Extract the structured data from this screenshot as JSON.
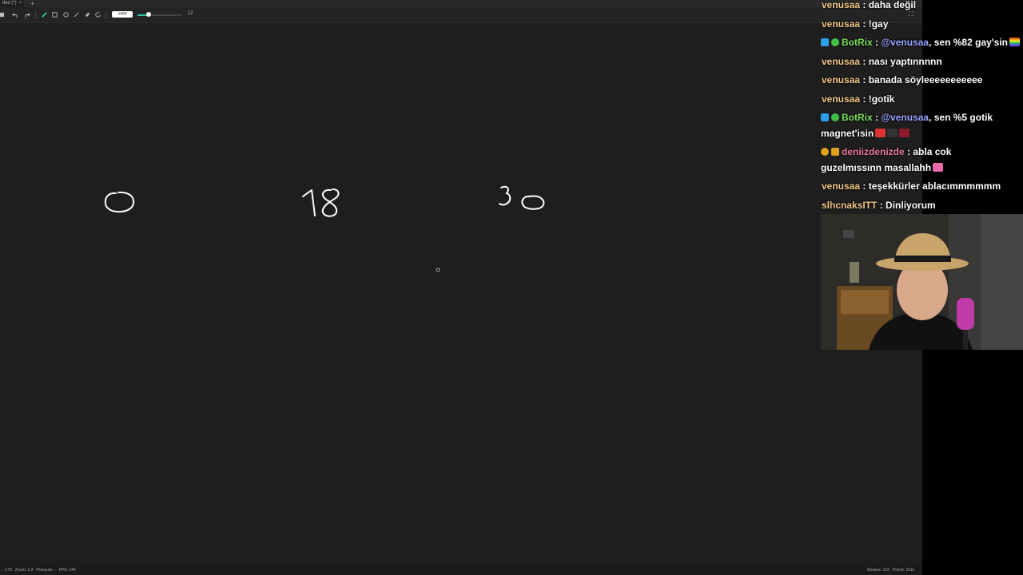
{
  "tab": {
    "title": "tled (*)",
    "close": "×",
    "new": "+"
  },
  "toolbar": {
    "icons": [
      "undo-icon",
      "redo-icon",
      "pen-icon",
      "rectangle-icon",
      "circle-icon",
      "line-icon",
      "eraser-icon",
      "refresh-icon"
    ],
    "color_label": "#ffffff",
    "brush_size_fraction": 0.25,
    "size_value": "12"
  },
  "canvas": {
    "drawn_texts": [
      "0",
      "18",
      "30"
    ]
  },
  "status": {
    "left": [
      ", -173",
      "Zoom: 1.3",
      "Pressure: -",
      "FPS: 144"
    ],
    "right": [
      "Strokes: 122",
      "Points: 2111"
    ]
  },
  "chat": {
    "messages": [
      {
        "user": "venusaa",
        "color": "#f2c98a",
        "text": " : daha değil"
      },
      {
        "user": "venusaa",
        "color": "#f2c98a",
        "text": " : !gay"
      },
      {
        "user": "BotRix",
        "color": "#7de35e",
        "badges": [
          "bot",
          "verified"
        ],
        "mention": "@venusaa",
        "text": ", sen %82 gay'sin"
      },
      {
        "user": "venusaa",
        "color": "#f2c98a",
        "text": " : nası yaptınnnnn"
      },
      {
        "user": "venusaa",
        "color": "#f2c98a",
        "text": " : banada söyleeeeeeeeeee"
      },
      {
        "user": "venusaa",
        "color": "#f2c98a",
        "text": " : !gotik"
      },
      {
        "user": "BotRix",
        "color": "#7de35e",
        "badges": [
          "bot",
          "verified"
        ],
        "mention": "@venusaa",
        "text": ", sen %5 gotik",
        "text2": "magnet'isin"
      },
      {
        "user": "deniizdenizde",
        "color": "#f07aa0",
        "badges": [
          "gold",
          "crown"
        ],
        "text": " : abla cok",
        "text2": "guzelmıssınn masallahh"
      },
      {
        "user": "venusaa",
        "color": "#f2c98a",
        "text": " : teşekkürler ablacımmmmmm"
      },
      {
        "user": "slhcnaksITT",
        "color": "#f2c98a",
        "text": " : Dinliyorum"
      }
    ]
  },
  "colors": {
    "accent": "#2ec4a6",
    "bg": "#1e1e1f"
  }
}
